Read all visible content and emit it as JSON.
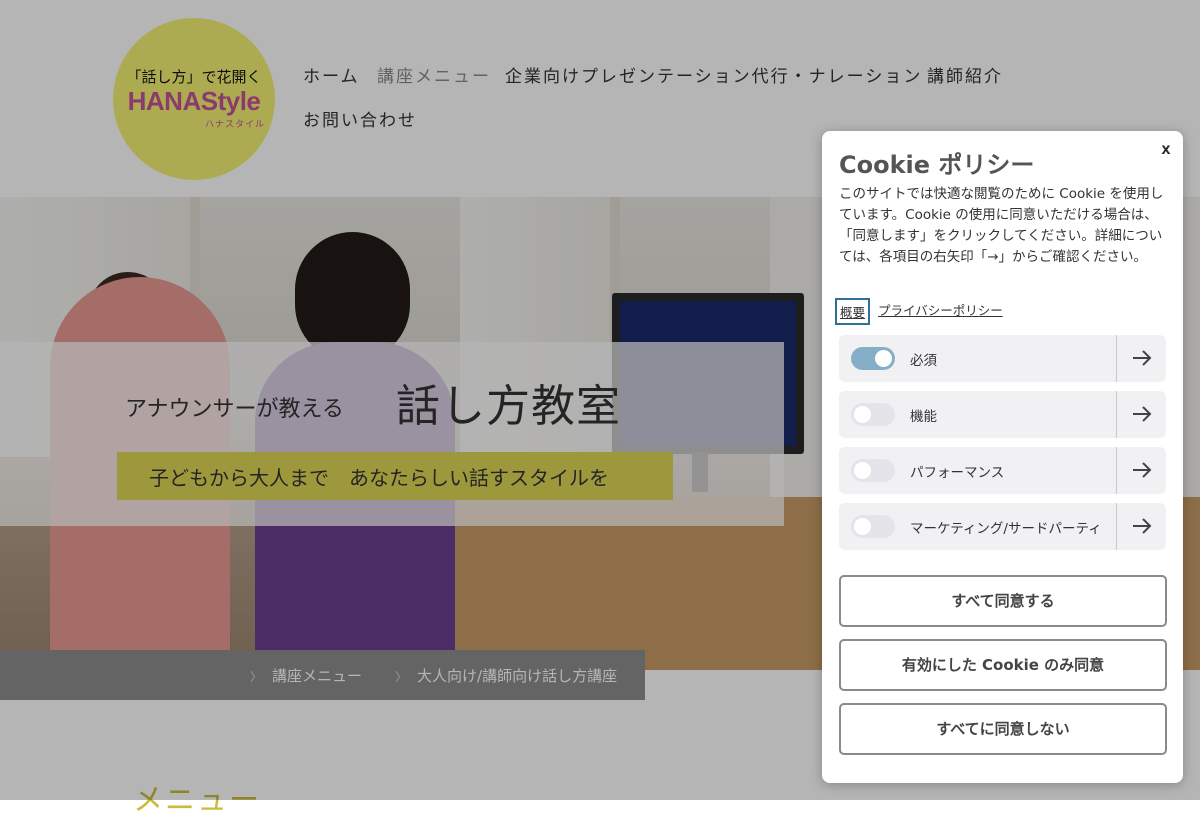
{
  "logo": {
    "tagline": "「話し方」で花開く",
    "name": "HANAStyle",
    "kana": "ハナスタイル"
  },
  "nav": {
    "items": [
      {
        "label": "ホーム",
        "active": false
      },
      {
        "label": "講座メニュー",
        "active": true
      },
      {
        "label": "企業向けプレゼンテーション代行・ナレーション",
        "active": false
      },
      {
        "label": "講師紹介",
        "active": false
      },
      {
        "label": "お問い合わせ",
        "active": false
      }
    ]
  },
  "hero": {
    "subtitle": "アナウンサーが教える",
    "title": "話し方教室",
    "tagline": "子どもから大人まで　あなたらしい話すスタイルを"
  },
  "breadcrumb": {
    "items": [
      "講座メニュー",
      "大人向け/講師向け話し方講座"
    ]
  },
  "page": {
    "menu_heading": "メニュー"
  },
  "cookie_dialog": {
    "close_label": "x",
    "title": "Cookie ポリシー",
    "description": "このサイトでは快適な閲覧のために Cookie を使用しています。Cookie の使用に同意いただける場合は、「同意します」をクリックしてください。詳細については、各項目の右矢印「→」からご確認ください。",
    "links": [
      "概要",
      "プライバシーポリシー"
    ],
    "categories": [
      {
        "label": "必須",
        "enabled": true
      },
      {
        "label": "機能",
        "enabled": false
      },
      {
        "label": "パフォーマンス",
        "enabled": false
      },
      {
        "label": "マーケティング/サードパーティ",
        "enabled": false
      }
    ],
    "buttons": {
      "accept_all": "すべて同意する",
      "accept_enabled": "有効にした Cookie のみ同意",
      "reject_all": "すべてに同意しない"
    }
  },
  "colors": {
    "logo_bg": "#f4f173",
    "logo_text": "#c6529a",
    "highlight_yellow": "#dfd757",
    "toggle_on": "#86aec7",
    "breadcrumb_bg": "#8e8e8e"
  }
}
